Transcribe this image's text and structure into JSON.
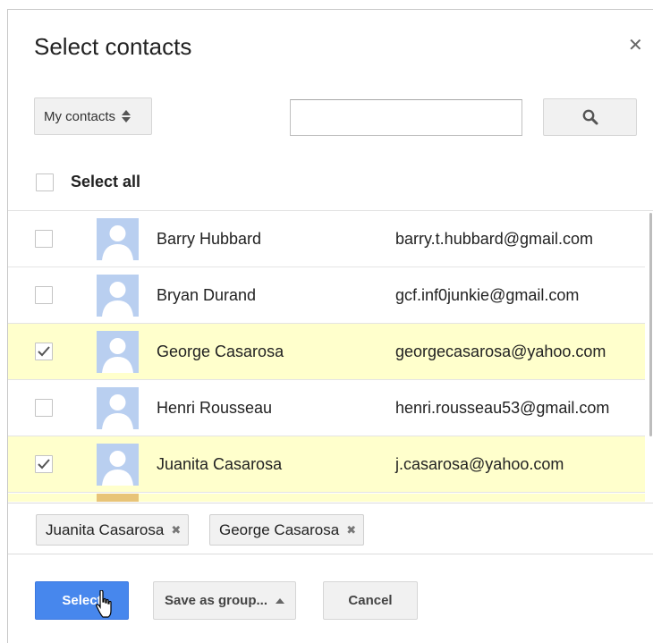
{
  "dialog": {
    "title": "Select contacts",
    "close_icon": "close-icon"
  },
  "toolbar": {
    "group_label": "My contacts",
    "search_value": "",
    "search_placeholder": "",
    "search_icon": "search-icon"
  },
  "select_all": {
    "label": "Select all",
    "checked": false
  },
  "contacts": [
    {
      "name": "Barry Hubbard",
      "email": "barry.t.hubbard@gmail.com",
      "checked": false
    },
    {
      "name": "Bryan Durand",
      "email": "gcf.inf0junkie@gmail.com",
      "checked": false
    },
    {
      "name": "George Casarosa",
      "email": "georgecasarosa@yahoo.com",
      "checked": true
    },
    {
      "name": "Henri Rousseau",
      "email": "henri.rousseau53@gmail.com",
      "checked": false
    },
    {
      "name": "Juanita Casarosa",
      "email": "j.casarosa@yahoo.com",
      "checked": true
    }
  ],
  "selected_chips": [
    {
      "label": "Juanita Casarosa"
    },
    {
      "label": "George Casarosa"
    }
  ],
  "buttons": {
    "select": "Select",
    "save_as_group": "Save as group...",
    "cancel": "Cancel"
  },
  "colors": {
    "primary": "#4787ed",
    "selected_row": "#ffffcc",
    "avatar_bg": "#b9cff0"
  }
}
